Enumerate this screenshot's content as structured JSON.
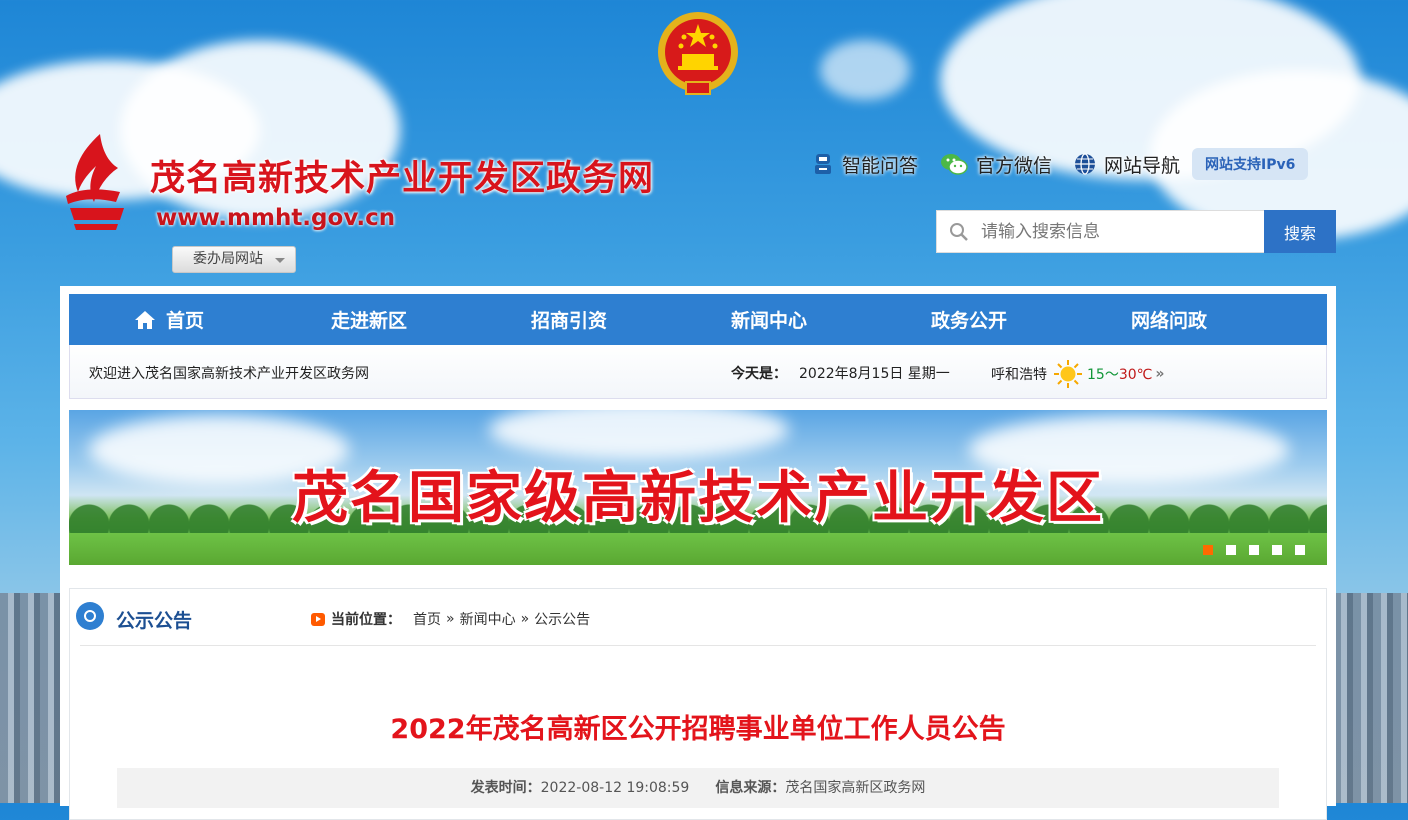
{
  "header": {
    "site_title": "茂名高新技术产业开发区政务网",
    "site_url": "www.mmht.gov.cn",
    "dropdown_label": "委办局网站",
    "links": [
      {
        "label": "智能问答",
        "icon": "robot-icon"
      },
      {
        "label": "官方微信",
        "icon": "wechat-icon"
      },
      {
        "label": "网站导航",
        "icon": "globe-icon"
      }
    ],
    "ipv6_badge": "网站支持IPv6",
    "search": {
      "placeholder": "请输入搜索信息",
      "button": "搜索"
    }
  },
  "nav": {
    "items": [
      "首页",
      "走进新区",
      "招商引资",
      "新闻中心",
      "政务公开",
      "网络问政"
    ]
  },
  "infobar": {
    "welcome": "欢迎进入茂名国家高新技术产业开发区政务网",
    "today_label": "今天是：",
    "date": "2022年8月15日 星期一",
    "city": "呼和浩特",
    "temp_low": "15～",
    "temp_high": "30℃",
    "more": "»"
  },
  "banner": {
    "text": "茂名国家级高新技术产业开发区",
    "slide_count": 5,
    "active_slide": 1
  },
  "section": {
    "title": "公示公告",
    "location_label": "当前位置：",
    "breadcrumb": [
      "首页",
      "新闻中心",
      "公示公告"
    ],
    "breadcrumb_sep": "»"
  },
  "article": {
    "title": "2022年茂名高新区公开招聘事业单位工作人员公告",
    "publish_label": "发表时间：",
    "publish_time": "2022-08-12 19:08:59",
    "source_label": "信息来源：",
    "source": "茂名国家高新区政务网"
  },
  "colors": {
    "title_red": "#d8141c",
    "nav_blue": "#2e7fd1",
    "search_button": "#2d72c6",
    "accent_orange": "#ff6a00"
  }
}
